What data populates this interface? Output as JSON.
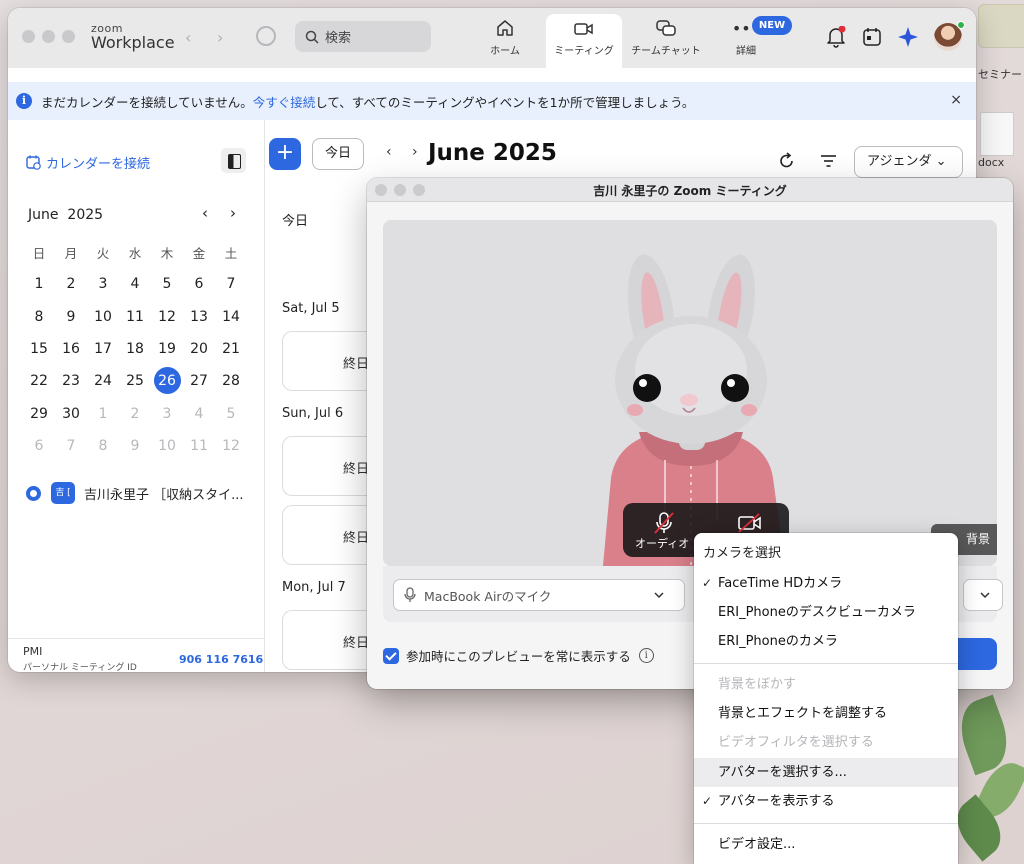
{
  "app": {
    "brand_small": "zoom",
    "brand_big": "Workplace",
    "search_label": "検索",
    "tabs": [
      {
        "label": "ホーム"
      },
      {
        "label": "ミーティング"
      },
      {
        "label": "チームチャット"
      },
      {
        "label": "詳細"
      }
    ],
    "new_badge": "NEW"
  },
  "banner": {
    "text_before": "まだカレンダーを接続していません。",
    "link": "今すぐ接続",
    "text_after": "して、すべてのミーティングやイベントを1か所で管理しましょう。",
    "close": "×"
  },
  "left": {
    "connect_label": "カレンダーを接続",
    "month": "June",
    "year": "2025",
    "weekdays": [
      "日",
      "月",
      "火",
      "水",
      "木",
      "金",
      "土"
    ],
    "weeks": [
      [
        "1",
        "2",
        "3",
        "4",
        "5",
        "6",
        "7"
      ],
      [
        "8",
        "9",
        "10",
        "11",
        "12",
        "13",
        "14"
      ],
      [
        "15",
        "16",
        "17",
        "18",
        "19",
        "20",
        "21"
      ],
      [
        "22",
        "23",
        "24",
        "25",
        "26",
        "27",
        "28"
      ],
      [
        "29",
        "30",
        "1",
        "2",
        "3",
        "4",
        "5"
      ],
      [
        "6",
        "7",
        "8",
        "9",
        "10",
        "11",
        "12"
      ]
    ],
    "owner_chip": "吉 [",
    "owner_label": "吉川永里子 ［収納スタイ...",
    "pmi_label": "PMI",
    "pmi_sub": "パーソナル ミーティング ID",
    "pmi_number": "906 116 7616"
  },
  "right": {
    "plus": "+",
    "today_btn": "今日",
    "prev": "‹",
    "next": "›",
    "month_title": "June 2025",
    "agenda_label": "アジェンダ ⌄",
    "today_heading": "今日",
    "day_sat": "Sat, Jul 5",
    "day_sun": "Sun, Jul 6",
    "day_mon": "Mon, Jul 7",
    "all_day": "終日"
  },
  "meeting": {
    "title": "吉川 永里子の Zoom ミーティング",
    "audio_label": "オーディオ",
    "background_label": "背景",
    "mic_select": "MacBook Airのマイク",
    "always_show": "参加時にこのプレビューを常に表示する"
  },
  "camera_menu": {
    "header": "カメラを選択",
    "cameras": [
      "FaceTime HDカメラ",
      "ERI_Phoneのデスクビューカメラ",
      "ERI_Phoneのカメラ"
    ],
    "blur": "背景をぼかす",
    "adjust": "背景とエフェクトを調整する",
    "filter": "ビデオフィルタを選択する",
    "choose_avatar": "アバターを選択する...",
    "show_avatar": "アバターを表示する",
    "video_settings": "ビデオ設定..."
  },
  "desktop": {
    "label_seminar": "セミナー",
    "label_docx": "docx"
  },
  "colors": {
    "accent": "#2d68e0",
    "banner_bg": "#e9f0fd",
    "hoodie": "#d9808b"
  }
}
